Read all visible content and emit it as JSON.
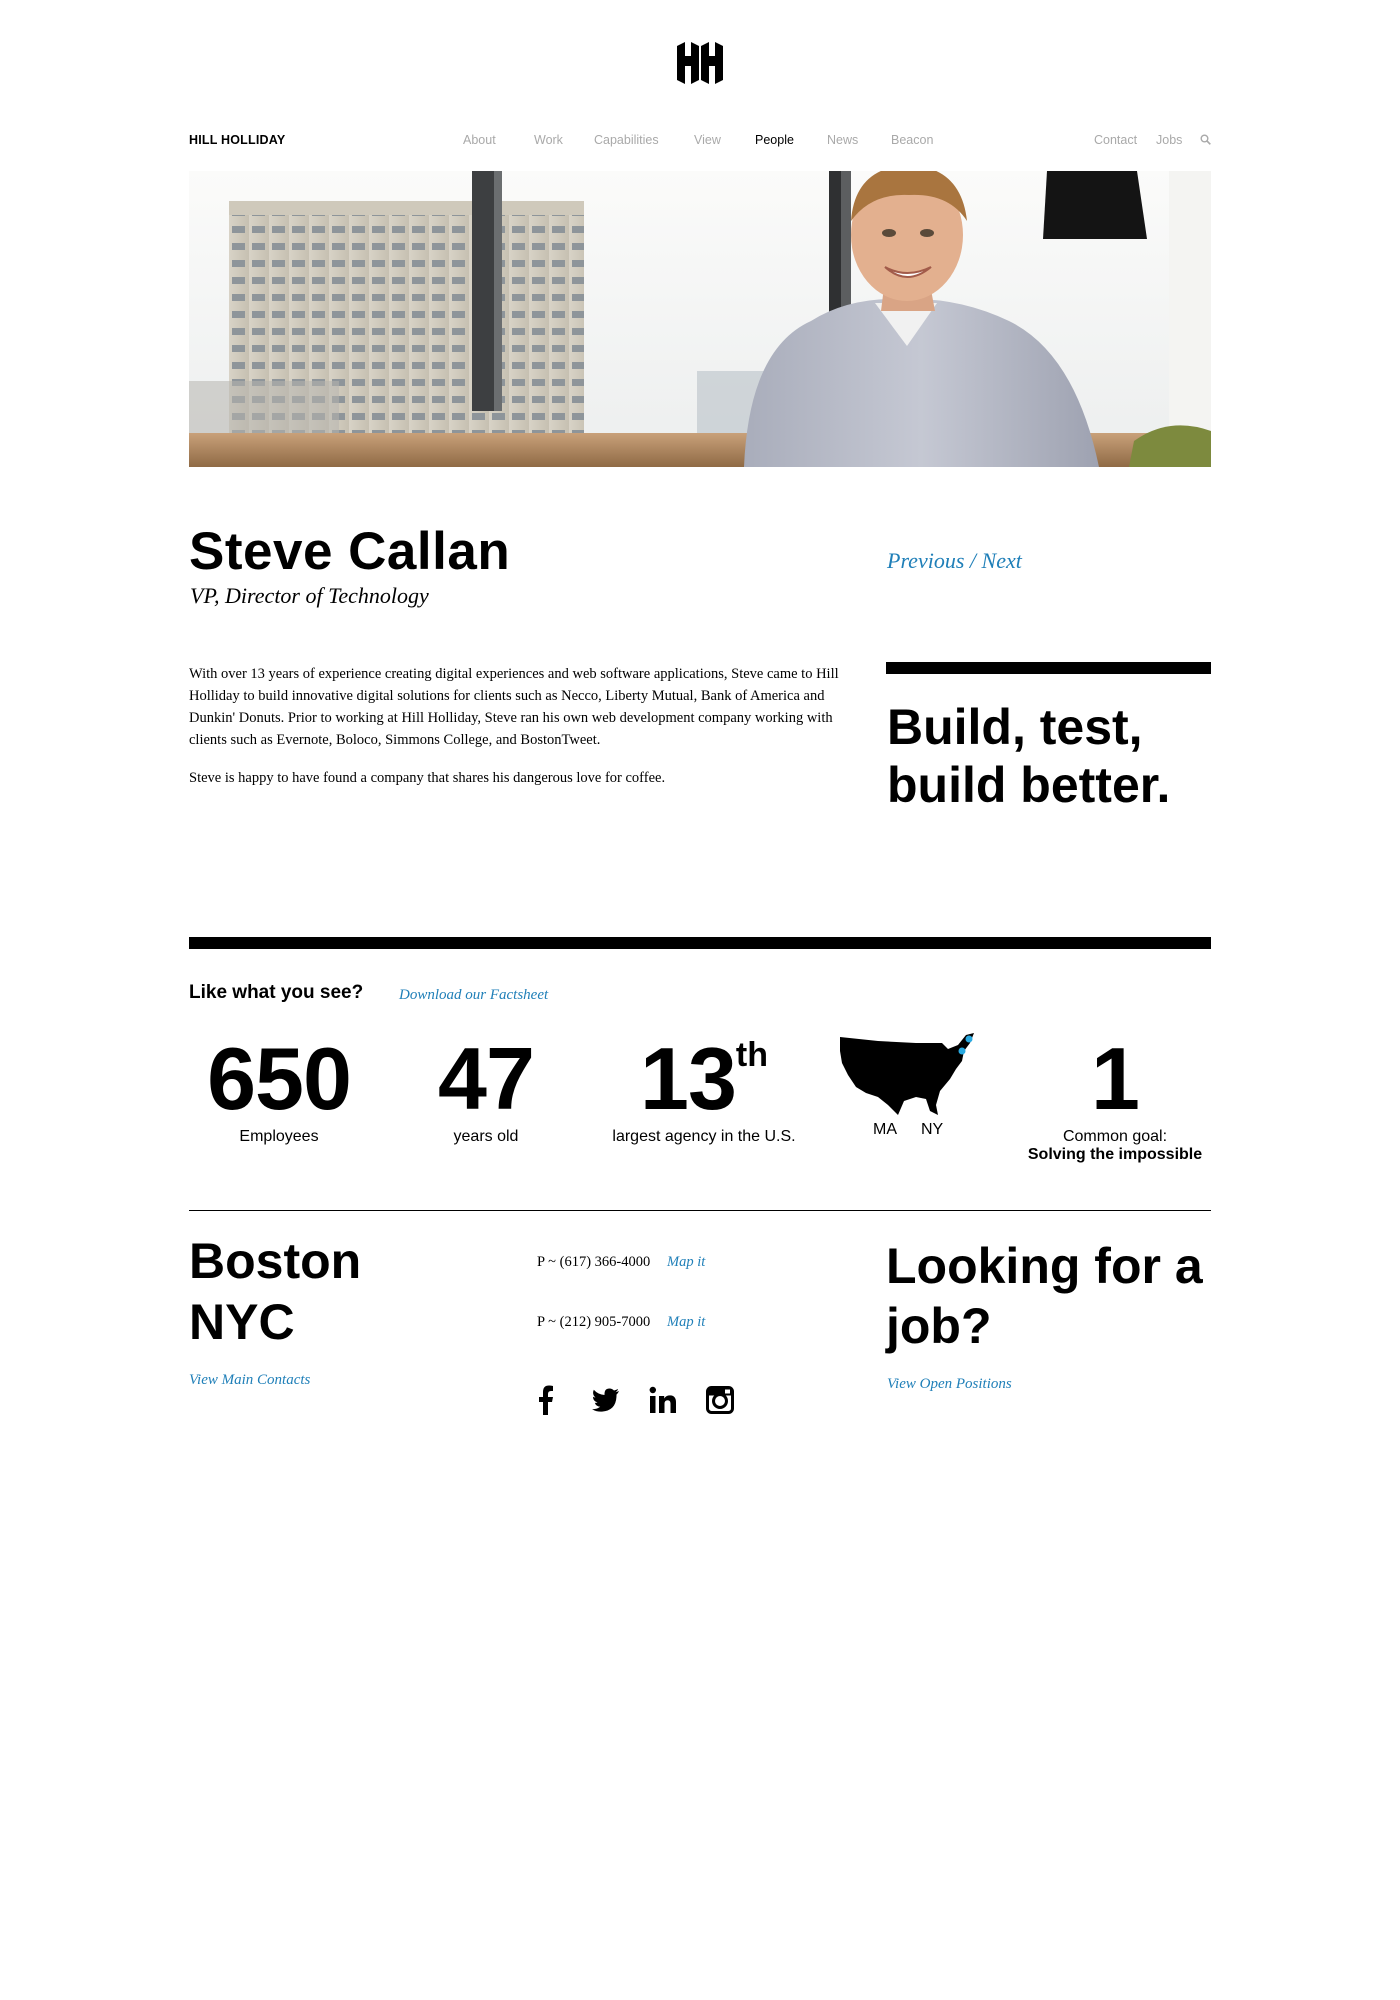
{
  "logo": {
    "icon": "hh-logo-icon"
  },
  "nav": {
    "brand": "HILL HOLLIDAY",
    "items": [
      {
        "label": "About"
      },
      {
        "label": "Work"
      },
      {
        "label": "Capabilities"
      },
      {
        "label": "View"
      },
      {
        "label": "People",
        "active": true
      },
      {
        "label": "News"
      },
      {
        "label": "Beacon"
      }
    ],
    "right": [
      {
        "label": "Contact"
      },
      {
        "label": "Jobs"
      }
    ],
    "search_icon": "search-icon"
  },
  "profile": {
    "name": "Steve Callan",
    "title": "VP, Director of Technology",
    "previous": "Previous",
    "separator": "/",
    "next": "Next",
    "bio": [
      "With over 13 years of experience creating digital experiences and web software applications, Steve came to Hill Holliday to build innovative digital solutions for clients such as Necco, Liberty Mutual, Bank of America and Dunkin' Donuts. Prior to working at Hill Holliday, Steve ran his own web development company working with clients such as Evernote, Boloco, Simmons College, and BostonTweet.",
      "Steve is happy to have found a company that shares his dangerous love for coffee."
    ],
    "quote": "Build, test, build better."
  },
  "stats": {
    "heading": "Like what you see?",
    "factsheet_link": "Download our Factsheet",
    "items": [
      {
        "number": "650",
        "label": "Employees"
      },
      {
        "number": "47",
        "label": "years old"
      },
      {
        "number": "13",
        "suffix": "th",
        "label": "largest agency in the U.S."
      },
      {
        "map_labels": [
          "MA",
          "NY"
        ]
      },
      {
        "number": "1",
        "label": "Common goal:",
        "label2": "Solving the impossible"
      }
    ],
    "map_highlight_color": "#29a9e0"
  },
  "footer": {
    "cities": [
      "Boston",
      "NYC"
    ],
    "main_contacts": "View Main Contacts",
    "phones": [
      {
        "text": "P ~ (617) 366-4000",
        "map": "Map it"
      },
      {
        "text": "P ~ (212) 905-7000",
        "map": "Map it"
      }
    ],
    "social": [
      "facebook-icon",
      "twitter-icon",
      "linkedin-icon",
      "instagram-icon"
    ],
    "job_heading": "Looking for a job?",
    "positions_link": "View Open Positions"
  },
  "colors": {
    "link": "#1f7fb8",
    "nav_inactive": "#a9a9a9",
    "text": "#000000"
  }
}
